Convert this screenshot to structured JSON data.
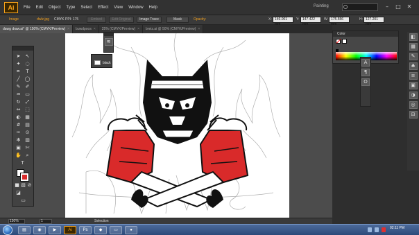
{
  "app": {
    "logo": "Ai",
    "workspace": "Painting",
    "search_placeholder": ""
  },
  "menu": [
    "File",
    "Edit",
    "Object",
    "Type",
    "Select",
    "Effect",
    "View",
    "Window",
    "Help"
  ],
  "control": {
    "type": "Image",
    "file": "dwlz.jpg",
    "mode": "CMYK",
    "ppi": "PPI: 175",
    "embed": "Embed",
    "edit_original": "Edit Original",
    "image_trace": "Image Trace",
    "mask": "Mask",
    "opacity": "Opacity:",
    "x_label": "X:",
    "x": "146.001 mm",
    "y_label": "Y:",
    "y": "147.422 mm",
    "w_label": "W:",
    "w": "175.556 mm",
    "h_label": "H:",
    "h": "127.201 mm"
  },
  "tabs": [
    {
      "label": "dawg draw.ai* @ 150% (CMYK/Preview)",
      "active": true
    },
    {
      "label": "buwdpoos",
      "active": false
    },
    {
      "label": "25% (CMYK/Preview)",
      "active": false
    },
    {
      "label": "breiz.ai @ 50% (CMYK/Preview)",
      "active": false
    }
  ],
  "status": {
    "zoom": "150%",
    "page": "1",
    "tool": "Selection"
  },
  "panels": {
    "color_title": "Color",
    "layer_popup": "black"
  },
  "taskbar": {
    "time": "02:11 PM",
    "date": ""
  },
  "colors": {
    "accent": "#f7a21b",
    "art_red": "#d92a2a",
    "chrome": "#323232"
  }
}
